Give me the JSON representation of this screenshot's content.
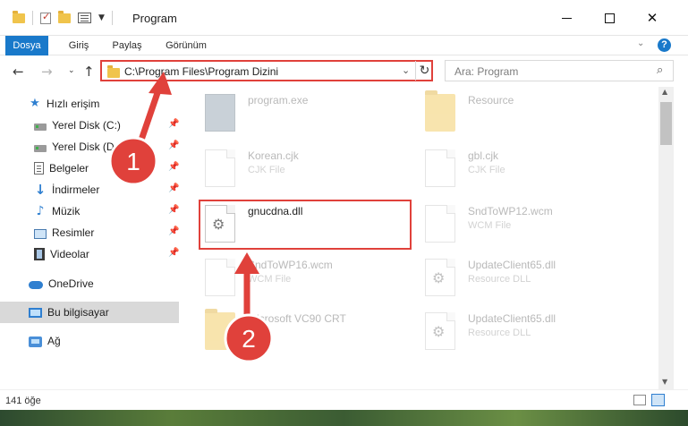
{
  "window": {
    "title": "Program",
    "controls": {
      "minimize": "–",
      "maximize": "□",
      "close": "✕"
    }
  },
  "ribbon": {
    "tabs": [
      {
        "label": "Dosya",
        "active": true
      },
      {
        "label": "Giriş"
      },
      {
        "label": "Paylaş"
      },
      {
        "label": "Görünüm"
      }
    ],
    "help": "?"
  },
  "address": {
    "path": "C:\\Program Files\\Program Dizini",
    "search_placeholder": "Ara: Program"
  },
  "nav": {
    "items": [
      {
        "label": "Hızlı erişim",
        "icon": "star-icon"
      },
      {
        "label": "Yerel Disk (C:)",
        "icon": "drive-icon",
        "pinned": true
      },
      {
        "label": "Yerel Disk (D:)",
        "icon": "drive-icon",
        "pinned": true
      },
      {
        "label": "Belgeler",
        "icon": "documents-icon",
        "pinned": true
      },
      {
        "label": "İndirmeler",
        "icon": "download-icon",
        "pinned": true
      },
      {
        "label": "Müzik",
        "icon": "music-icon",
        "pinned": true
      },
      {
        "label": "Resimler",
        "icon": "pictures-icon",
        "pinned": true
      },
      {
        "label": "Videolar",
        "icon": "videos-icon",
        "pinned": true
      },
      {
        "label": "OneDrive",
        "icon": "onedrive-icon"
      },
      {
        "label": "Bu bilgisayar",
        "icon": "this-pc-icon",
        "selected": true
      },
      {
        "label": "Ağ",
        "icon": "network-icon"
      }
    ]
  },
  "files": [
    {
      "name": "program.exe",
      "type": "",
      "icon": "exe-icon"
    },
    {
      "name": "Resource",
      "type": "",
      "icon": "folder-icon"
    },
    {
      "name": "Korean.cjk",
      "type": "CJK File",
      "icon": "file-icon"
    },
    {
      "name": "gbl.cjk",
      "type": "CJK File",
      "icon": "file-icon"
    },
    {
      "name": "gnucdna.dll",
      "type": "",
      "icon": "dll-icon"
    },
    {
      "name": "SndToWP12.wcm",
      "type": "WCM File",
      "icon": "file-icon"
    },
    {
      "name": "SndToWP16.wcm",
      "type": "WCM File",
      "icon": "file-icon"
    },
    {
      "name": "UpdateClient65.dll",
      "type": "Resource DLL",
      "icon": "dll-icon"
    },
    {
      "name": "Microsoft VC90 CRT",
      "type": "",
      "icon": "folder-icon"
    },
    {
      "name": "UpdateClient65.dll",
      "type": "Resource DLL",
      "icon": "dll-icon"
    }
  ],
  "annotations": {
    "step1": "1",
    "step2": "2",
    "color": "#e0413b"
  },
  "status": {
    "count": "141 öğe"
  }
}
